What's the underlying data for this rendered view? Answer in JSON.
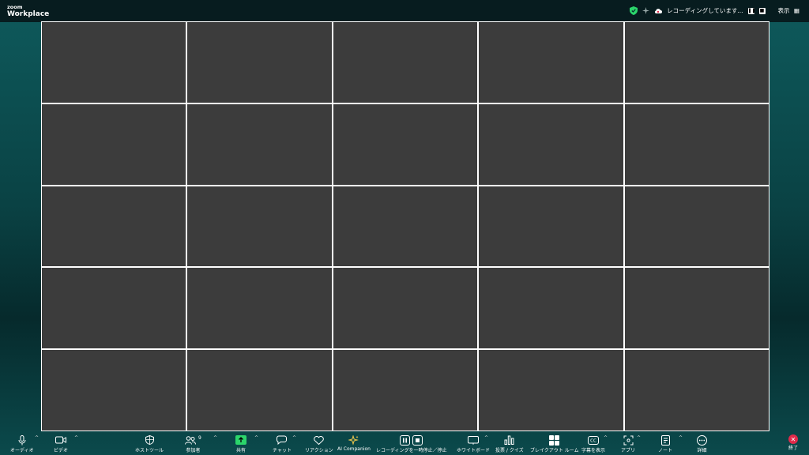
{
  "app": {
    "logo_small": "zoom",
    "logo_big": "Workplace"
  },
  "status": {
    "recording_text": "レコーディングしています...",
    "view_label": "表示"
  },
  "grid": {
    "rows": 5,
    "cols": 5
  },
  "toolbar": {
    "audio": "オーディオ",
    "video": "ビデオ",
    "host_tools": "ホストツール",
    "participants": "参加者",
    "participants_count": "9",
    "share": "共有",
    "chat": "チャット",
    "reactions": "リアクション",
    "ai_companion": "AI Companion",
    "recording": "レコーディングを一時停止／停止",
    "whiteboard": "ホワイトボード",
    "polls": "投票 / クイズ",
    "breakout": "ブレイクアウト ルーム",
    "captions": "字幕を表示",
    "apps": "アプリ",
    "notes": "ノート",
    "more": "詳細",
    "end": "終了"
  },
  "colors": {
    "accent_green": "#2bd56b",
    "end_red": "#e02a4a",
    "tile": "#3c3c3c"
  }
}
